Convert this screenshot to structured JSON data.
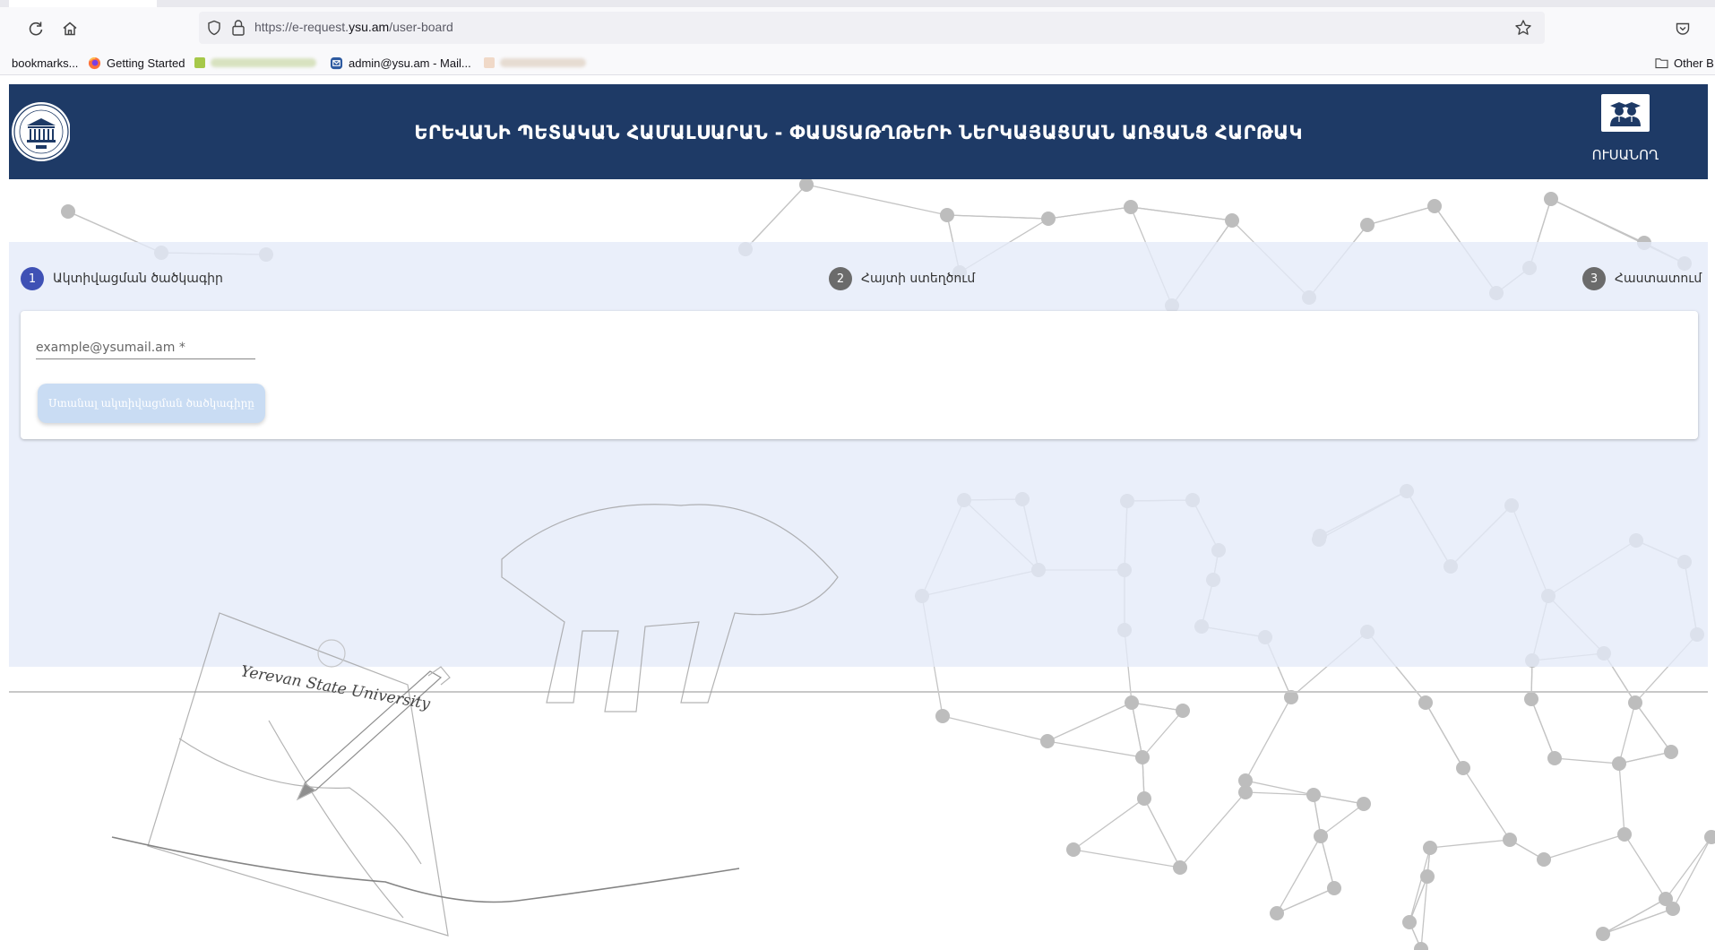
{
  "browser": {
    "url_prefix": "https://e-request.",
    "url_domain": "ysu.am",
    "url_path": "/user-board",
    "bookmarks": [
      {
        "label": "bookmarks..."
      },
      {
        "label": "Getting Started"
      },
      {
        "label": "admin@ysu.am - Mail..."
      }
    ],
    "other_bookmarks": "Other B"
  },
  "header": {
    "title": "ԵՐԵՎԱՆԻ ՊԵՏԱԿԱՆ ՀԱՄԱԼՍԱՐԱՆ - ՓԱՍՏԱԹՂԹԵՐԻ ՆԵՐԿԱՅԱՑՄԱՆ ԱՌՑԱՆՑ ՀԱՐԹԱԿ",
    "user_role": "ՈՒՍԱՆՈՂ"
  },
  "stepper": {
    "steps": [
      {
        "number": "1",
        "label": "Ակտիվացման ծածկագիր",
        "active": true
      },
      {
        "number": "2",
        "label": "Հայտի ստեղծում",
        "active": false
      },
      {
        "number": "3",
        "label": "Հաստատում",
        "active": false
      }
    ]
  },
  "form": {
    "email_placeholder": "example@ysumail.am *",
    "email_value": "",
    "send_button_label": "Ստանալ ակտիվացման ծածկագիրը"
  },
  "sketch": {
    "handwriting": "Yerevan State University"
  },
  "colors": {
    "header_bg": "#1e3a66",
    "step_active": "#3f51b5",
    "step_inactive": "#6b6b6b",
    "button_disabled": "#c9dcf3"
  }
}
